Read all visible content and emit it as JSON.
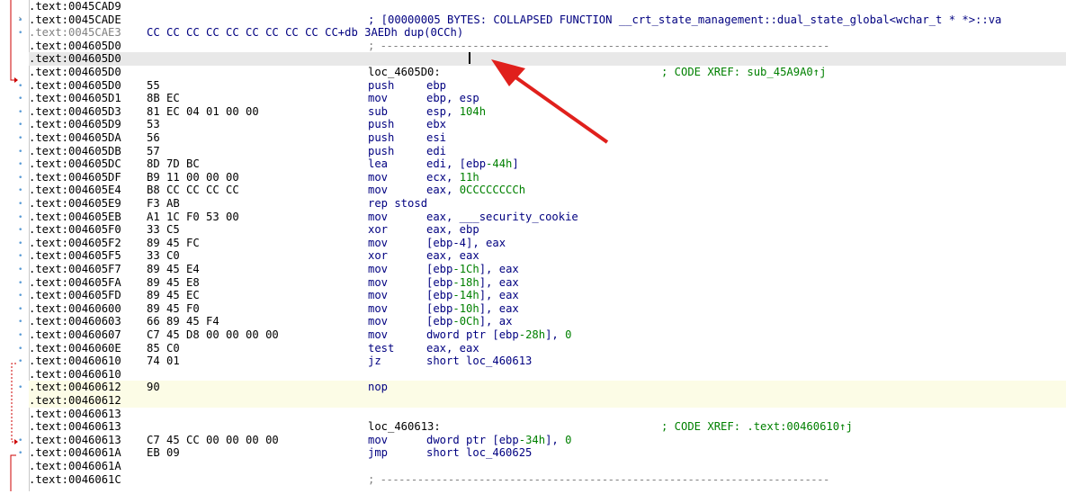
{
  "accent_colors": {
    "address": "#000000",
    "mnemonic": "#000080",
    "number": "#008000",
    "comment": "#008000",
    "flow_arrow": "#cc0000",
    "annotation_arrow": "#e0201c",
    "cursor_row": "#e8e8e8",
    "nop_row": "#fcfce6"
  },
  "rows": [
    {
      "addr": ".text:0045CAD9",
      "kind": "blank"
    },
    {
      "addr": ".text:0045CADE",
      "kind": "note",
      "text": "; [00000005 BYTES: COLLAPSED FUNCTION __crt_state_management::dual_state_global<wchar_t * *>::va"
    },
    {
      "addr": ".text:0045CAE3",
      "kind": "db",
      "text": "CC CC CC CC CC CC CC CC CC CC+db 3AEDh dup(0CCh)"
    },
    {
      "addr": ".text:004605D0",
      "kind": "sep",
      "text": "; -------------------------------------------------------------------------"
    },
    {
      "addr": ".text:004605D0",
      "kind": "cursor"
    },
    {
      "addr": ".text:004605D0",
      "kind": "label",
      "label": "loc_4605D0:",
      "comment": "; CODE XREF: sub_45A9A0↑j"
    },
    {
      "addr": ".text:004605D0",
      "bytes": "55",
      "mnem": "push",
      "ops": "ebp"
    },
    {
      "addr": ".text:004605D1",
      "bytes": "8B EC",
      "mnem": "mov",
      "ops": "ebp, esp"
    },
    {
      "addr": ".text:004605D3",
      "bytes": "81 EC 04 01 00 00",
      "mnem": "sub",
      "ops": "esp, 104h"
    },
    {
      "addr": ".text:004605D9",
      "bytes": "53",
      "mnem": "push",
      "ops": "ebx"
    },
    {
      "addr": ".text:004605DA",
      "bytes": "56",
      "mnem": "push",
      "ops": "esi"
    },
    {
      "addr": ".text:004605DB",
      "bytes": "57",
      "mnem": "push",
      "ops": "edi"
    },
    {
      "addr": ".text:004605DC",
      "bytes": "8D 7D BC",
      "mnem": "lea",
      "ops": "edi, [ebp-44h]"
    },
    {
      "addr": ".text:004605DF",
      "bytes": "B9 11 00 00 00",
      "mnem": "mov",
      "ops": "ecx, 11h"
    },
    {
      "addr": ".text:004605E4",
      "bytes": "B8 CC CC CC CC",
      "mnem": "mov",
      "ops": "eax, 0CCCCCCCCh"
    },
    {
      "addr": ".text:004605E9",
      "bytes": "F3 AB",
      "mnem": "rep stosd",
      "ops": ""
    },
    {
      "addr": ".text:004605EB",
      "bytes": "A1 1C F0 53 00",
      "mnem": "mov",
      "ops": "eax, ___security_cookie"
    },
    {
      "addr": ".text:004605F0",
      "bytes": "33 C5",
      "mnem": "xor",
      "ops": "eax, ebp"
    },
    {
      "addr": ".text:004605F2",
      "bytes": "89 45 FC",
      "mnem": "mov",
      "ops": "[ebp-4], eax"
    },
    {
      "addr": ".text:004605F5",
      "bytes": "33 C0",
      "mnem": "xor",
      "ops": "eax, eax"
    },
    {
      "addr": ".text:004605F7",
      "bytes": "89 45 E4",
      "mnem": "mov",
      "ops": "[ebp-1Ch], eax"
    },
    {
      "addr": ".text:004605FA",
      "bytes": "89 45 E8",
      "mnem": "mov",
      "ops": "[ebp-18h], eax"
    },
    {
      "addr": ".text:004605FD",
      "bytes": "89 45 EC",
      "mnem": "mov",
      "ops": "[ebp-14h], eax"
    },
    {
      "addr": ".text:00460600",
      "bytes": "89 45 F0",
      "mnem": "mov",
      "ops": "[ebp-10h], eax"
    },
    {
      "addr": ".text:00460603",
      "bytes": "66 89 45 F4",
      "mnem": "mov",
      "ops": "[ebp-0Ch], ax"
    },
    {
      "addr": ".text:00460607",
      "bytes": "C7 45 D8 00 00 00 00",
      "mnem": "mov",
      "ops": "dword ptr [ebp-28h], 0"
    },
    {
      "addr": ".text:0046060E",
      "bytes": "85 C0",
      "mnem": "test",
      "ops": "eax, eax"
    },
    {
      "addr": ".text:00460610",
      "bytes": "74 01",
      "mnem": "jz",
      "ops": "short loc_460613"
    },
    {
      "addr": ".text:00460610",
      "kind": "blank"
    },
    {
      "addr": ".text:00460612",
      "bytes": "90",
      "mnem": "nop",
      "ops": "",
      "kind": "nop"
    },
    {
      "addr": ".text:00460612",
      "kind": "nopblank"
    },
    {
      "addr": ".text:00460613",
      "kind": "blank"
    },
    {
      "addr": ".text:00460613",
      "kind": "label",
      "label": "loc_460613:",
      "comment": "; CODE XREF: .text:00460610↑j"
    },
    {
      "addr": ".text:00460613",
      "bytes": "C7 45 CC 00 00 00 00",
      "mnem": "mov",
      "ops": "dword ptr [ebp-34h], 0"
    },
    {
      "addr": ".text:0046061A",
      "bytes": "EB 09",
      "mnem": "jmp",
      "ops": "short loc_460625"
    },
    {
      "addr": ".text:0046061A",
      "kind": "blank"
    },
    {
      "addr": ".text:0046061C",
      "kind": "sep",
      "text": "; -------------------------------------------------------------------------"
    }
  ]
}
